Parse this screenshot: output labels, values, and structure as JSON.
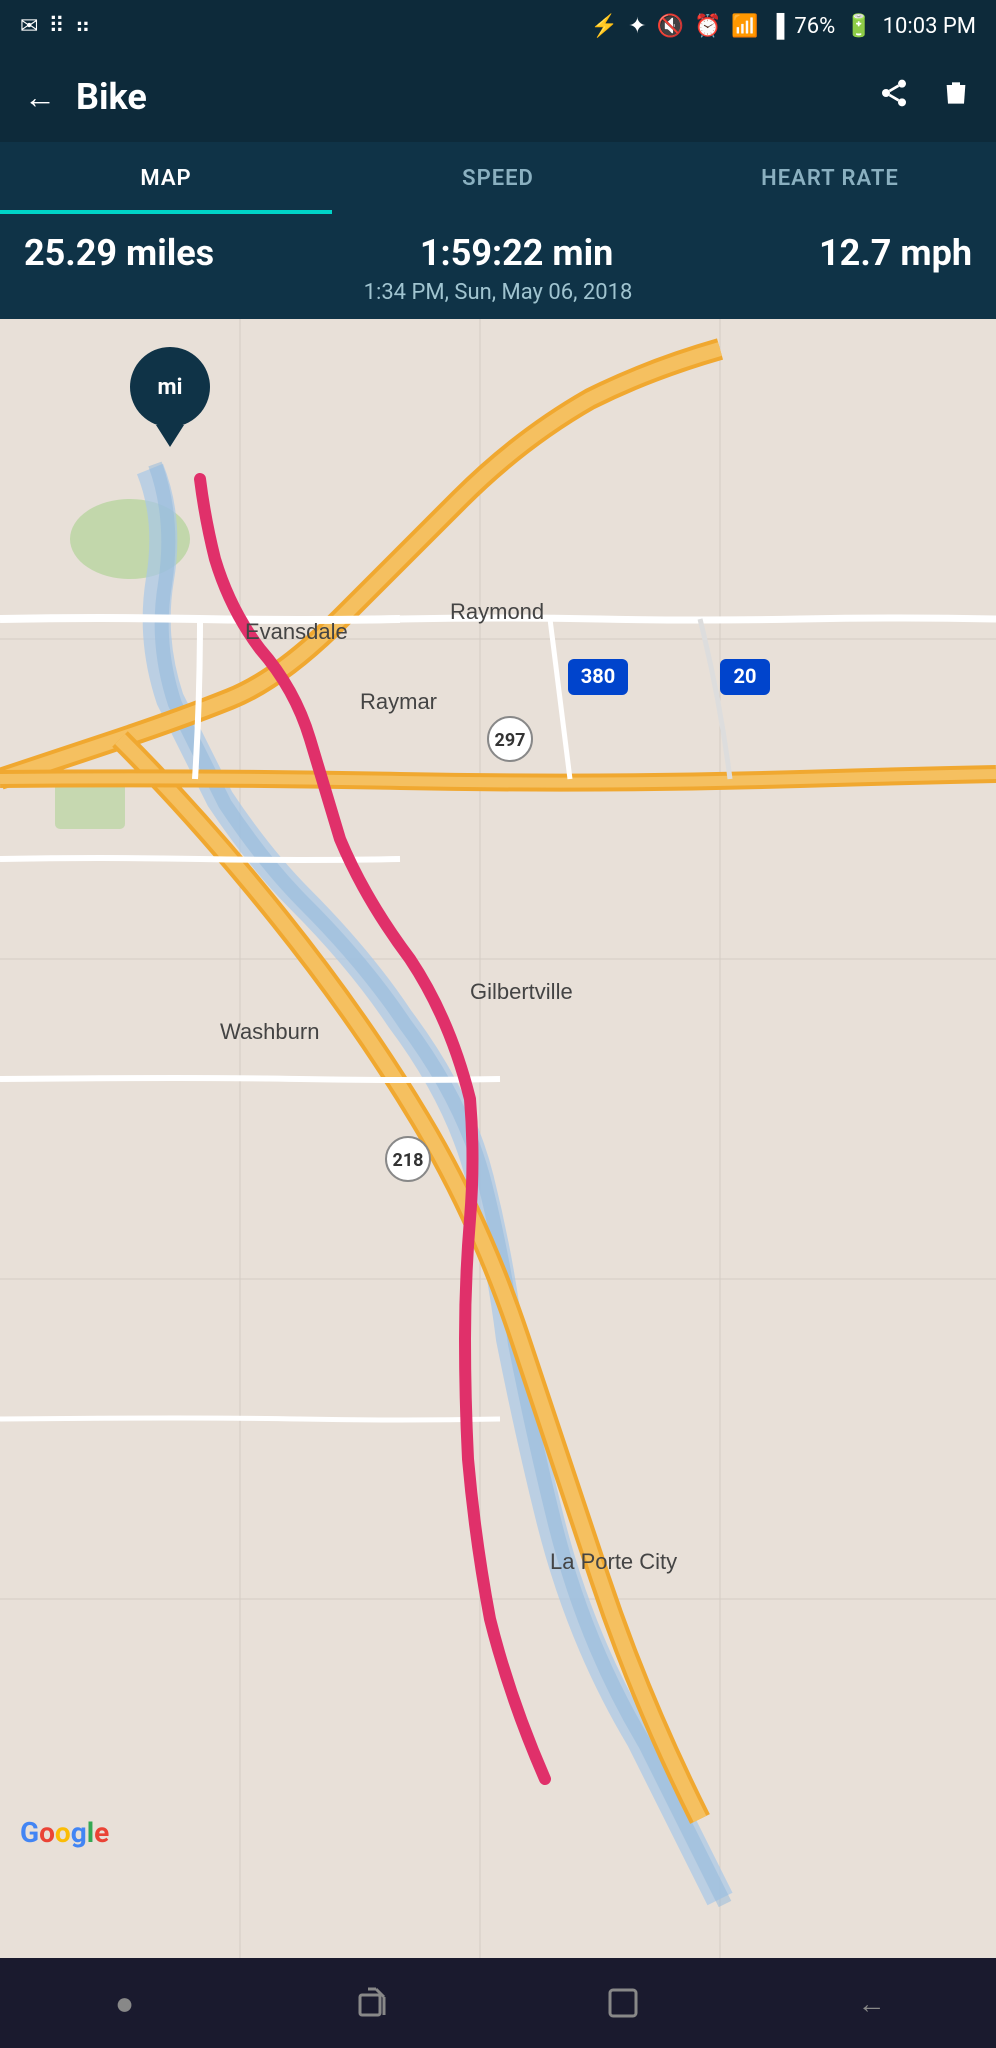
{
  "statusBar": {
    "leftIcons": [
      "mail-icon",
      "grid-icon",
      "dots-icon"
    ],
    "rightIcons": [
      "battery-icon",
      "bluetooth-icon",
      "mute-icon",
      "alarm-icon",
      "wifi-icon",
      "signal-icon"
    ],
    "battery": "76%",
    "time": "10:03 PM"
  },
  "header": {
    "title": "Bike",
    "backLabel": "←",
    "shareLabel": "⬡",
    "deleteLabel": "🗑"
  },
  "tabs": [
    {
      "id": "map",
      "label": "MAP",
      "active": true
    },
    {
      "id": "speed",
      "label": "SPEED",
      "active": false
    },
    {
      "id": "heartrate",
      "label": "HEART RATE",
      "active": false
    }
  ],
  "stats": {
    "distance": "25.29 miles",
    "duration": "1:59:22 min",
    "speed": "12.7 mph",
    "datetime": "1:34 PM, Sun, May 06, 2018"
  },
  "map": {
    "pinLabel": "mi",
    "places": [
      "Evansdale",
      "Raymond",
      "Raymar",
      "Washburn",
      "Gilbertville",
      "La Porte City"
    ],
    "highways": [
      "380",
      "297",
      "218",
      "20"
    ]
  },
  "bottomNav": [
    {
      "id": "home",
      "icon": "●"
    },
    {
      "id": "recent",
      "icon": "⊣"
    },
    {
      "id": "square",
      "icon": "▢"
    },
    {
      "id": "back",
      "icon": "←"
    }
  ],
  "googleLogo": "Google"
}
